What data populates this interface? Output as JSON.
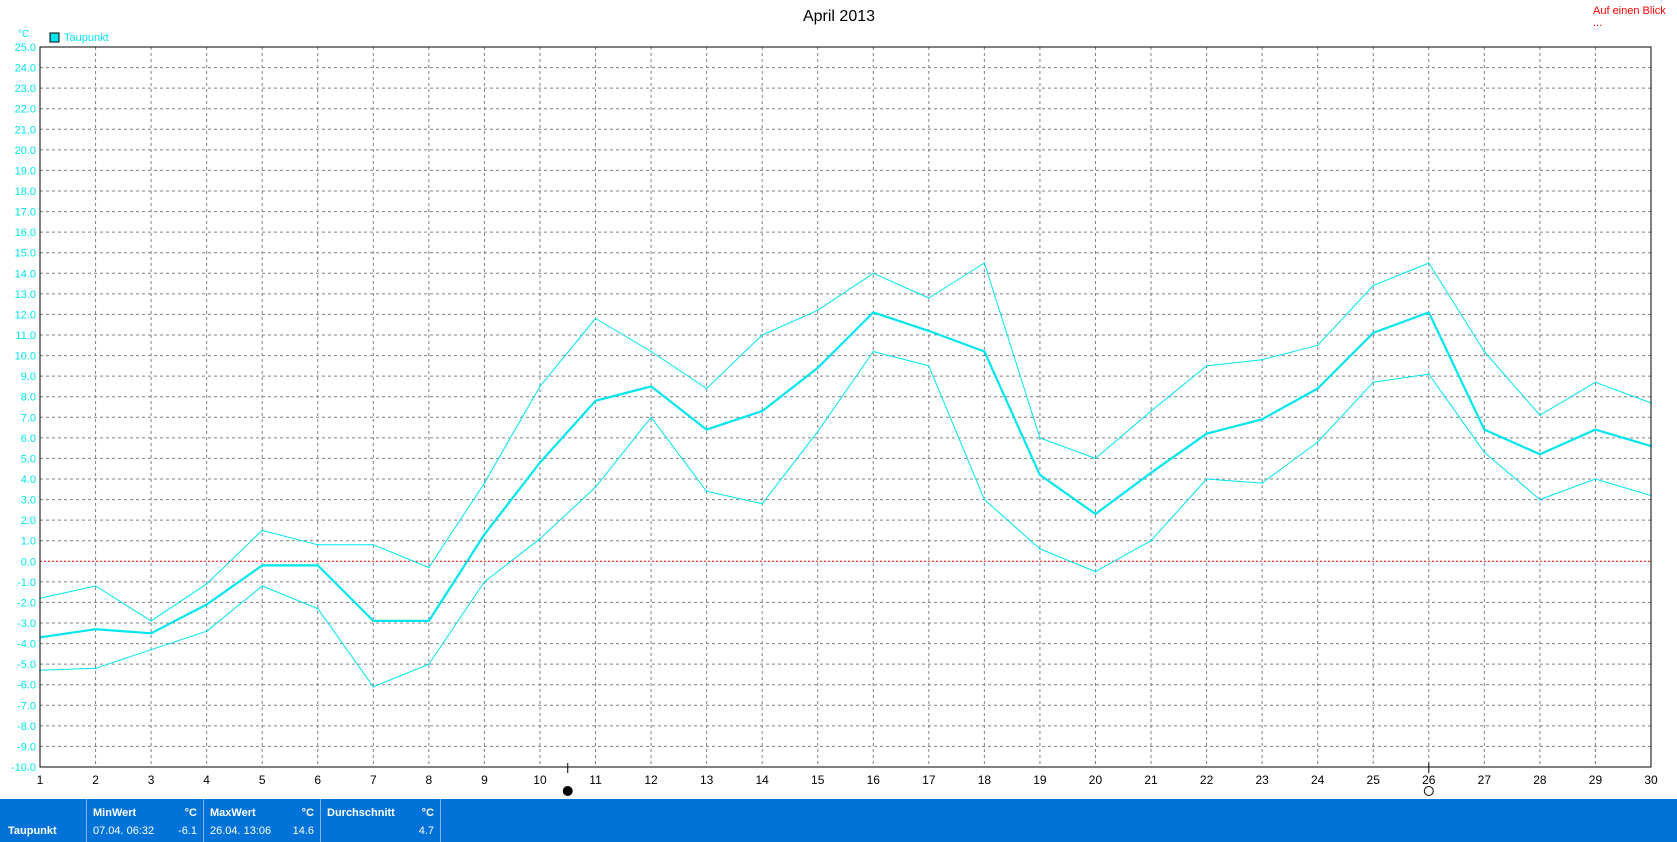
{
  "title": "April 2013",
  "overview_link": "Auf einen Blick ...",
  "unit_label": "°C",
  "legend": {
    "label": "Taupunkt",
    "color": "#00e5ee"
  },
  "colors": {
    "series": "#00e5ee",
    "zero_line": "#ff0000",
    "grid": "#808080",
    "stats_bg": "#0072d8"
  },
  "moon_markers": [
    {
      "day": 10.5,
      "icon": "new-moon-icon"
    },
    {
      "day": 26,
      "icon": "full-moon-icon"
    }
  ],
  "chart_data": {
    "type": "line",
    "x_ticks": [
      "1",
      "2",
      "3",
      "4",
      "5",
      "6",
      "7",
      "8",
      "9",
      "10",
      "11",
      "12",
      "13",
      "14",
      "15",
      "16",
      "17",
      "18",
      "19",
      "20",
      "21",
      "22",
      "23",
      "24",
      "25",
      "26",
      "27",
      "28",
      "29",
      "30"
    ],
    "y_ticks": [
      "25.0",
      "24.0",
      "23.0",
      "22.0",
      "21.0",
      "20.0",
      "19.0",
      "18.0",
      "17.0",
      "16.0",
      "15.0",
      "14.0",
      "13.0",
      "12.0",
      "11.0",
      "10.0",
      "9.0",
      "8.0",
      "7.0",
      "6.0",
      "5.0",
      "4.0",
      "3.0",
      "2.0",
      "1.0",
      "0.0",
      "-1.0",
      "-2.0",
      "-3.0",
      "-4.0",
      "-5.0",
      "-6.0",
      "-7.0",
      "-8.0",
      "-9.0",
      "-10.0"
    ],
    "xlim": [
      1,
      30
    ],
    "ylim": [
      -10,
      25
    ],
    "grid": true,
    "x": [
      1,
      2,
      3,
      4,
      5,
      6,
      7,
      8,
      9,
      10,
      11,
      12,
      13,
      14,
      15,
      16,
      17,
      18,
      19,
      20,
      21,
      22,
      23,
      24,
      25,
      26,
      27,
      28,
      29,
      30
    ],
    "series": [
      {
        "role": "max",
        "width": 1,
        "values": [
          -1.8,
          -1.2,
          -2.9,
          -1.1,
          1.5,
          0.8,
          0.8,
          -0.3,
          3.8,
          8.5,
          11.8,
          10.2,
          8.4,
          11.0,
          12.2,
          14.0,
          12.8,
          14.5,
          6.0,
          5.0,
          7.3,
          9.5,
          9.8,
          10.5,
          13.4,
          14.5,
          10.2,
          7.1,
          8.7,
          7.7
        ]
      },
      {
        "role": "avg",
        "width": 2.2,
        "values": [
          -3.7,
          -3.3,
          -3.5,
          -2.1,
          -0.2,
          -0.2,
          -2.9,
          -2.9,
          1.3,
          4.8,
          7.8,
          8.5,
          6.4,
          7.3,
          9.4,
          12.1,
          11.2,
          10.2,
          4.2,
          2.3,
          4.3,
          6.2,
          6.9,
          8.4,
          11.1,
          12.1,
          6.4,
          5.2,
          6.4,
          5.6
        ]
      },
      {
        "role": "min",
        "width": 1,
        "values": [
          -5.3,
          -5.2,
          -4.3,
          -3.4,
          -1.2,
          -2.3,
          -6.1,
          -5.0,
          -1.0,
          1.1,
          3.6,
          7.0,
          3.4,
          2.8,
          6.3,
          10.2,
          9.5,
          3.0,
          0.6,
          -0.5,
          1.0,
          4.0,
          3.8,
          5.8,
          8.7,
          9.1,
          5.3,
          3.0,
          4.0,
          3.2
        ]
      }
    ]
  },
  "stats": {
    "row_label": "Taupunkt",
    "min": {
      "header": "MinWert",
      "unit": "°C",
      "time": "07.04.  06:32",
      "value": "-6.1"
    },
    "max": {
      "header": "MaxWert",
      "unit": "°C",
      "time": "26.04.  13:06",
      "value": "14.6"
    },
    "avg": {
      "header": "Durchschnitt",
      "unit": "°C",
      "value": "4.7"
    }
  }
}
